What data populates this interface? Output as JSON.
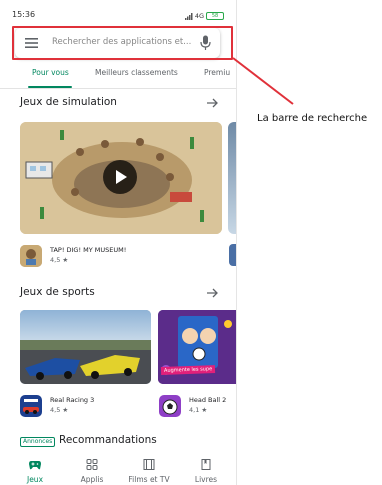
{
  "status_bar": {
    "time": "15:36",
    "network": "4G",
    "battery": "58"
  },
  "search": {
    "placeholder": "Rechercher des applications et..."
  },
  "tabs": [
    {
      "label": "Pour vous"
    },
    {
      "label": "Meilleurs classements"
    },
    {
      "label": "Premiu"
    }
  ],
  "sections": {
    "simulation": {
      "title": "Jeux de simulation",
      "apps": [
        {
          "name": "TAP! DIG! MY MUSEUM!",
          "rating": "4,5 ★"
        }
      ]
    },
    "sports": {
      "title": "Jeux de sports",
      "banner_text": "Augmente les supe",
      "apps": [
        {
          "name": "Real Racing 3",
          "rating": "4,5 ★"
        },
        {
          "name": "Head Ball 2",
          "rating": "4,1 ★"
        }
      ]
    },
    "recommendations": {
      "badge": "Annonces",
      "title": "Recommandations"
    }
  },
  "bottom_nav": [
    {
      "label": "Jeux",
      "icon": "gamepad-icon"
    },
    {
      "label": "Applis",
      "icon": "apps-grid-icon"
    },
    {
      "label": "Films et TV",
      "icon": "film-icon"
    },
    {
      "label": "Livres",
      "icon": "book-icon"
    }
  ],
  "annotation": {
    "text": "La barre de recherche"
  },
  "colors": {
    "accent": "#01875f",
    "highlight": "#e0313a"
  }
}
